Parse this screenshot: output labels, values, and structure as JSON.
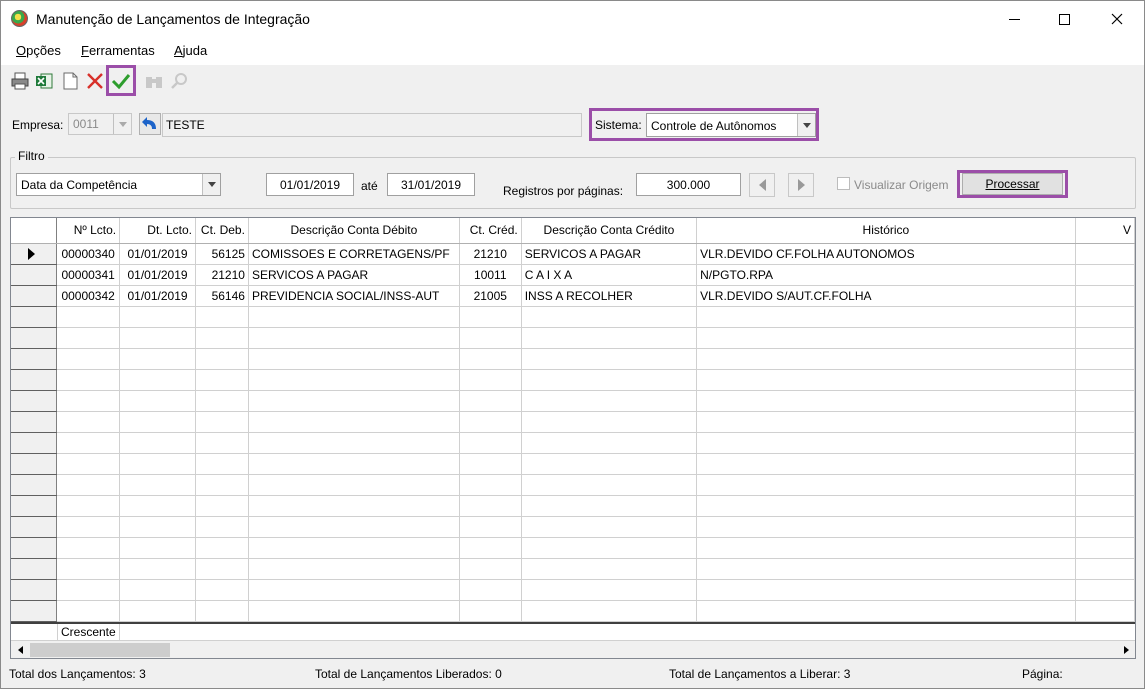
{
  "window": {
    "title": "Manutenção de Lançamentos de Integração"
  },
  "menu": [
    {
      "pre": "",
      "u": "O",
      "post": "pções"
    },
    {
      "pre": "",
      "u": "F",
      "post": "erramentas"
    },
    {
      "pre": "",
      "u": "A",
      "post": "juda"
    }
  ],
  "toolbar": {
    "icons": [
      "printer-icon",
      "excel-icon",
      "document-icon",
      "delete-icon",
      "confirm-icon",
      "binoculars-icon",
      "search-icon"
    ]
  },
  "empresa": {
    "label": "Empresa:",
    "code": "0011",
    "name": "TESTE"
  },
  "sistema": {
    "label": "Sistema:",
    "value": "Controle de Autônomos"
  },
  "filtro": {
    "label": "Filtro",
    "tipo": "Data da Competência",
    "data_inicio": "01/01/2019",
    "ate_label": "até",
    "data_fim": "31/01/2019",
    "registros_label": "Registros por páginas:",
    "registros_value": "300.000",
    "visualizar_origem": "Visualizar Origem",
    "processar": "Processar"
  },
  "grid": {
    "columns": [
      "Nº Lcto.",
      "Dt. Lcto.",
      "Ct. Deb.",
      "Descrição Conta Débito",
      "Ct. Créd.",
      "Descrição Conta Crédito",
      "Histórico",
      "V"
    ],
    "rows": [
      [
        "00000340",
        "01/01/2019",
        "56125",
        "COMISSOES E CORRETAGENS/PF",
        "21210",
        "SERVICOS A PAGAR",
        "VLR.DEVIDO CF.FOLHA AUTONOMOS"
      ],
      [
        "00000341",
        "01/01/2019",
        "21210",
        "SERVICOS A PAGAR",
        "10011",
        "C A I X A",
        "N/PGTO.RPA"
      ],
      [
        "00000342",
        "01/01/2019",
        "56146",
        "PREVIDENCIA SOCIAL/INSS-AUT",
        "21005",
        "INSS A RECOLHER",
        "VLR.DEVIDO S/AUT.CF.FOLHA"
      ]
    ],
    "footer_label": "Crescente"
  },
  "status": {
    "total_lancamentos": "Total dos Lançamentos: 3",
    "liberados": "Total de Lançamentos Liberados: 0",
    "a_liberar": "Total de Lançamentos a Liberar: 3",
    "pagina": "Página:"
  },
  "colors": {
    "highlight": "#9b4ea8",
    "confirm": "#2e9e2e",
    "delete": "#d8302a"
  }
}
